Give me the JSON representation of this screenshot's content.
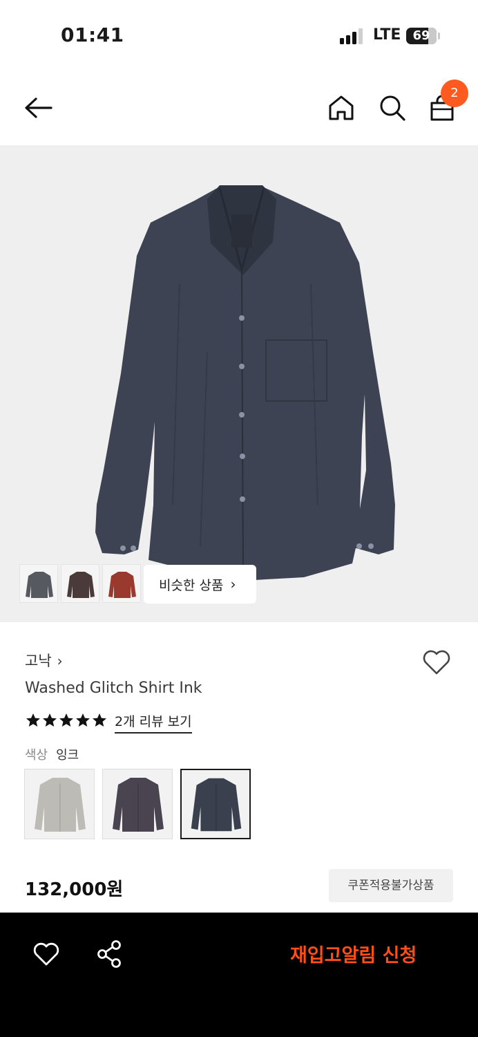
{
  "status_bar": {
    "time": "01:41",
    "network": "LTE",
    "battery": "69"
  },
  "nav": {
    "back_icon": "arrow-left-icon",
    "home_icon": "home-icon",
    "search_icon": "search-icon",
    "bag_icon": "shopping-bag-icon",
    "cart_count": "2"
  },
  "hero": {
    "similar_label": "비슷한 상품",
    "similar_chevron": "›",
    "thumbnails": [
      "gray-shirt",
      "brown-shirt",
      "red-check-shirt"
    ]
  },
  "product": {
    "brand": "고낙",
    "brand_chevron": "›",
    "name": "Washed Glitch Shirt Ink",
    "rating_stars": 5,
    "review_link": "2개 리뷰 보기",
    "color_label": "색상",
    "color_value": "잉크",
    "color_options": [
      "gray",
      "plum",
      "ink"
    ],
    "selected_color": "ink",
    "price": "132,000원",
    "coupon_note": "쿠폰적용불가상품"
  },
  "bottom_bar": {
    "restock_label": "재입고알림 신청",
    "accent_color": "#ff4e16"
  },
  "colors": {
    "badge": "#ff5a1f",
    "shirt_ink": "#3a404e"
  }
}
